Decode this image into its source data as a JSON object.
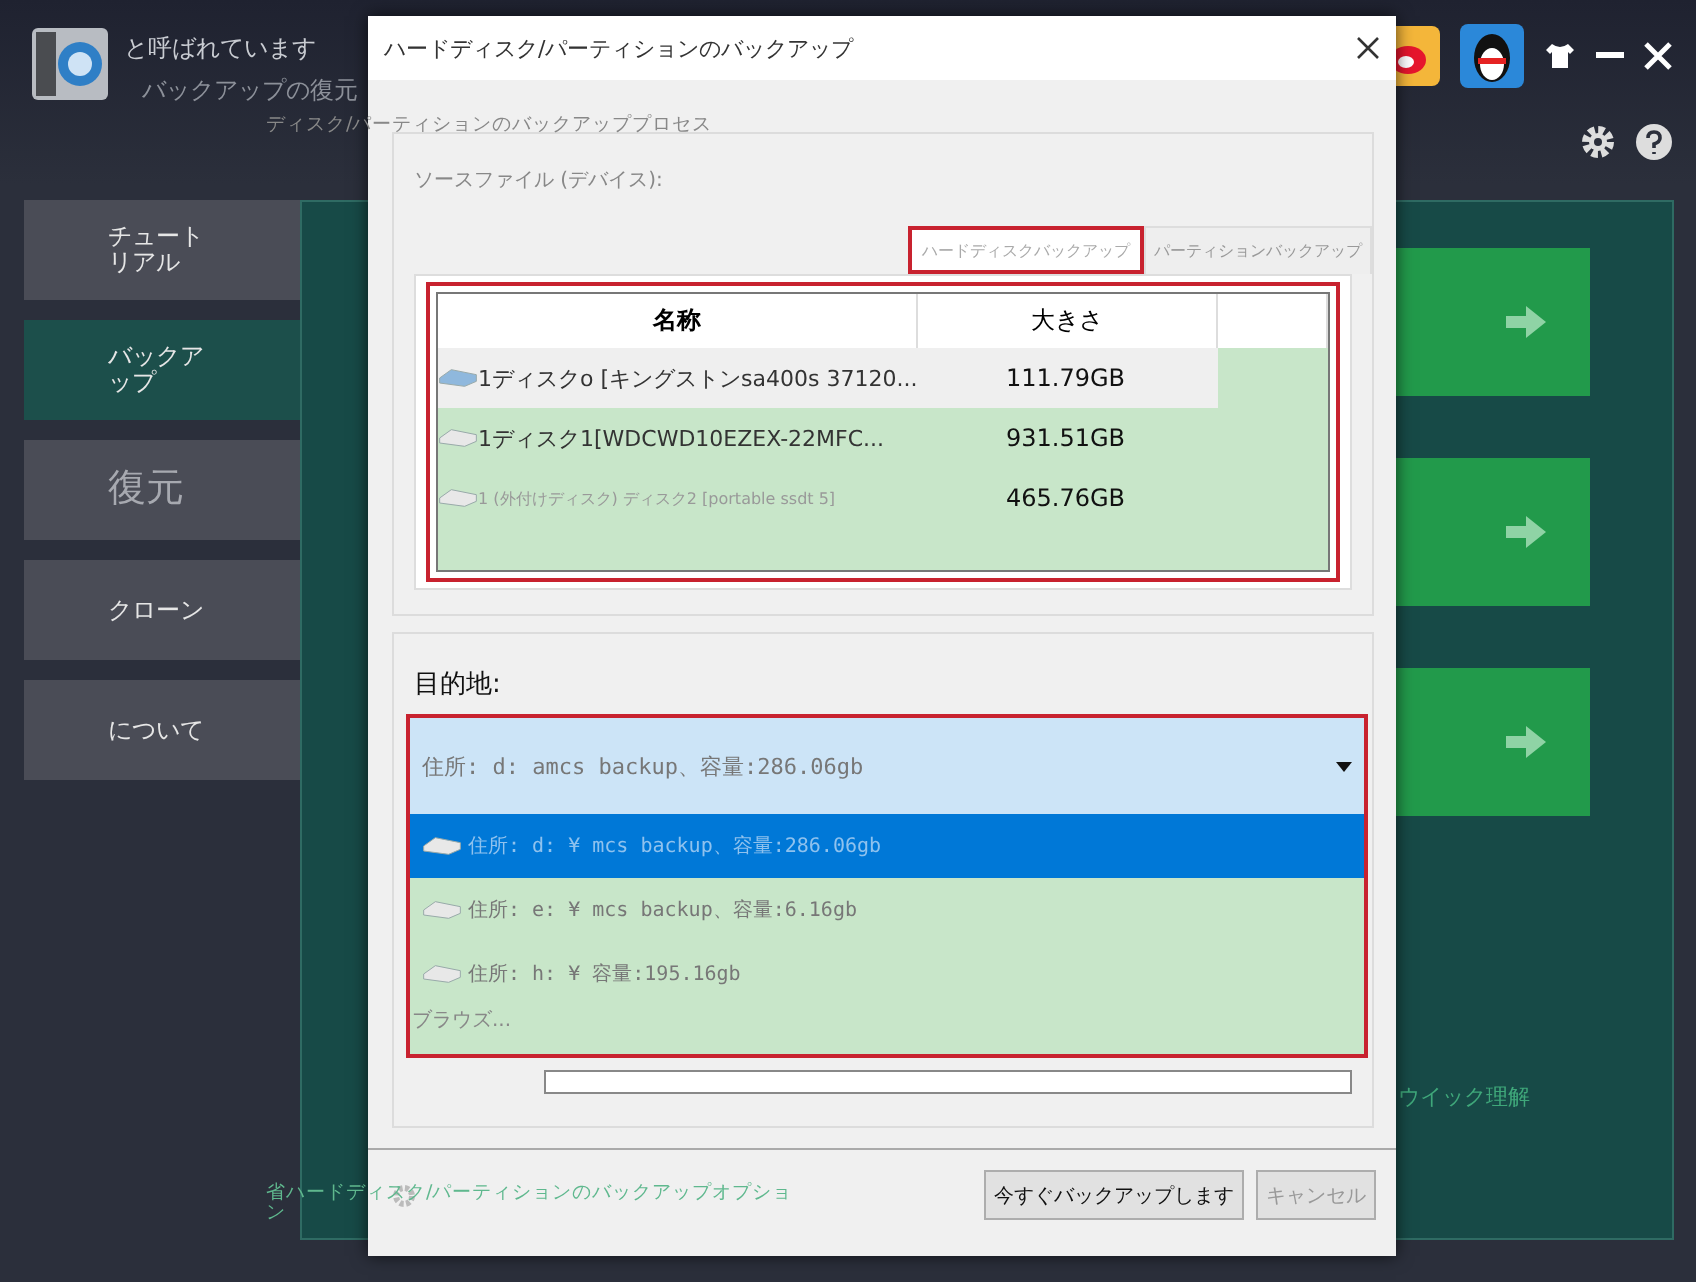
{
  "app": {
    "title_lines": [
      "と呼ばれています",
      "バックアップの復元"
    ],
    "sidebar": [
      {
        "label": "チュートリアル",
        "selected": false,
        "kind": "small"
      },
      {
        "label": "バックアップ",
        "selected": true,
        "kind": "small"
      },
      {
        "label": "復元",
        "selected": false,
        "kind": "large"
      },
      {
        "label": "クローン",
        "selected": false,
        "kind": "small"
      },
      {
        "label": "について",
        "selected": false,
        "kind": "small"
      }
    ],
    "hint": "ウイック理解",
    "process_label": "ディスク/パーティションのバックアッププロセス",
    "option_link": "省ハードディスク/パーティションのバックアップオプション"
  },
  "dialog": {
    "title": "ハードディスク/パーティションのバックアップ",
    "source_label": "ソースファイル (デバイス):",
    "tabs": [
      {
        "label": "ハードディスクバックアップ",
        "selected": true
      },
      {
        "label": "パーティションバックアップ",
        "selected": false
      }
    ],
    "table": {
      "columns": [
        "名称",
        "大きさ"
      ],
      "rows": [
        {
          "name": "1ディスクo [キングストンsa400s 37120...",
          "size": "111.79GB",
          "selected": true,
          "disabled": false
        },
        {
          "name": "1ディスク1[WDCWD10EZEX-22MFC...",
          "size": "931.51GB",
          "selected": false,
          "disabled": false
        },
        {
          "name": "1 (外付けディスク) ディスク2 [portable ssdt 5]",
          "size": "465.76GB",
          "selected": false,
          "disabled": true
        }
      ]
    },
    "destination": {
      "label": "目的地:",
      "value": "住所: d: amcs backup、容量:286.06gb",
      "options": [
        {
          "label": "住所: d: ¥ mcs backup、容量:286.06gb",
          "selected": true
        },
        {
          "label": "住所: e: ¥ mcs backup、容量:6.16gb",
          "selected": false
        },
        {
          "label": "住所: h: ¥ 容量:195.16gb",
          "selected": false
        }
      ],
      "browse": "ブラウズ..."
    },
    "buttons": [
      {
        "label": "今すぐバックアップします",
        "disabled": false
      },
      {
        "label": "キャンセル",
        "disabled": true
      }
    ]
  }
}
